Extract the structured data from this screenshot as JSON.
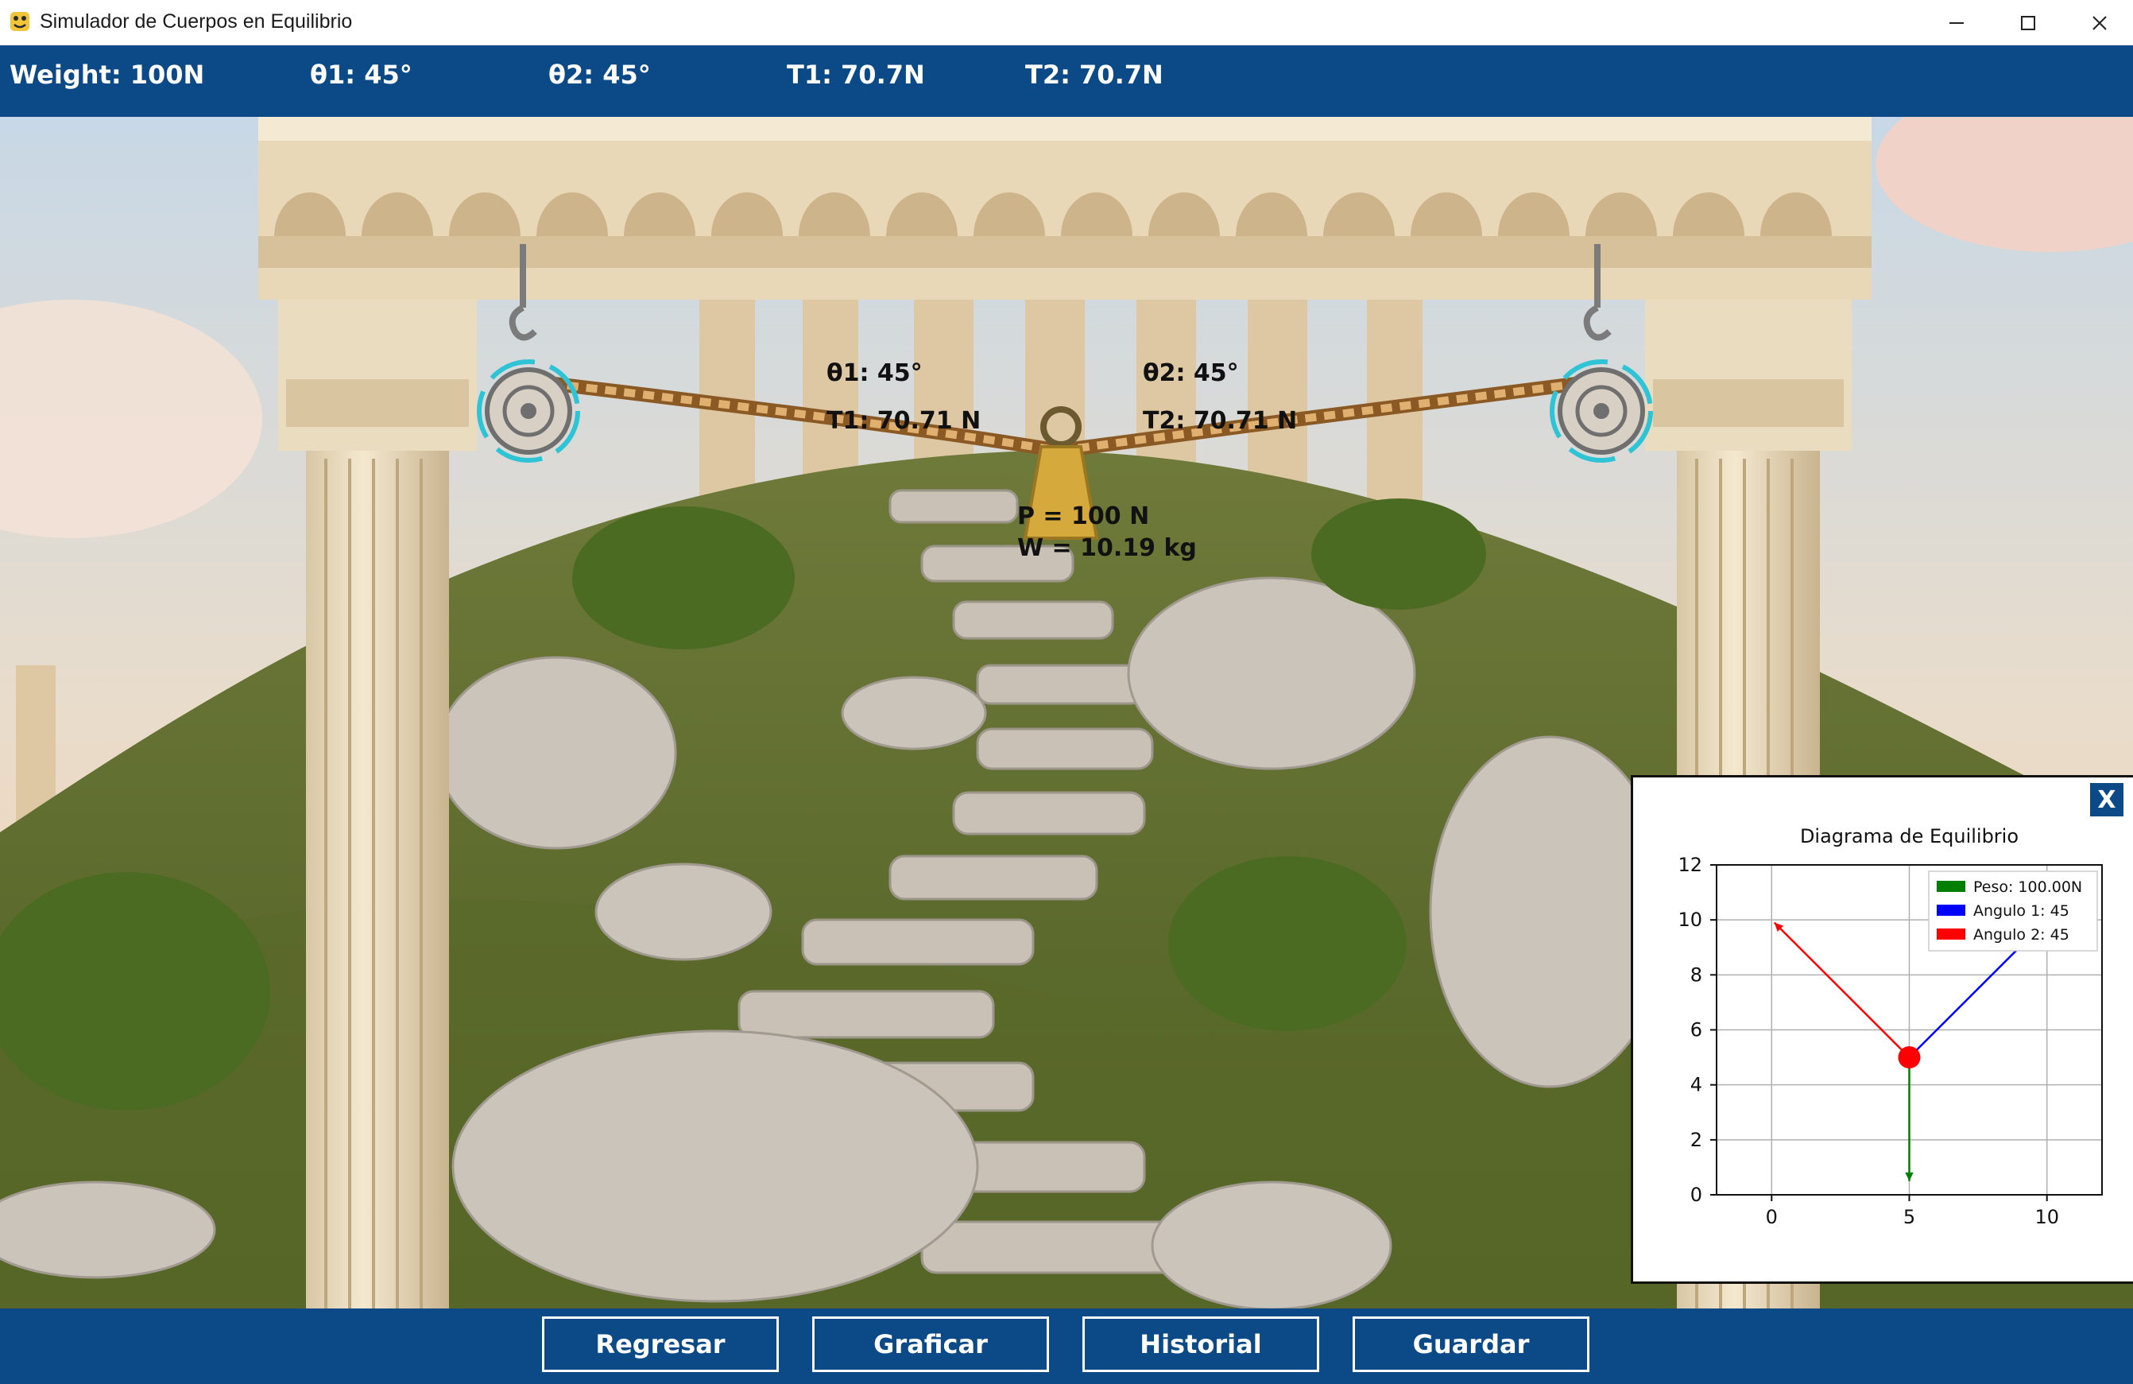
{
  "window": {
    "title": "Simulador de Cuerpos en Equilibrio"
  },
  "status": {
    "weight": "Weight: 100N",
    "theta1": "θ1: 45°",
    "theta2": "θ2: 45°",
    "t1": "T1: 70.7N",
    "t2": "T2: 70.7N"
  },
  "scene": {
    "left_angle": "θ1: 45°",
    "left_tension": "T1: 70.71 N",
    "right_angle": "θ2: 45°",
    "right_tension": "T2: 70.71 N",
    "weight_p": "P = 100 N",
    "weight_w": "W = 10.19 kg"
  },
  "buttons": {
    "back": "Regresar",
    "plot": "Graficar",
    "history": "Historial",
    "save": "Guardar"
  },
  "panel": {
    "close_label": "X"
  },
  "chart_data": {
    "type": "line",
    "title": "Diagrama de Equilibrio",
    "xlabel": "",
    "ylabel": "",
    "xlim": [
      -2,
      12
    ],
    "ylim": [
      0,
      12
    ],
    "xticks": [
      0,
      5,
      10
    ],
    "yticks": [
      0,
      2,
      4,
      6,
      8,
      10,
      12
    ],
    "grid": true,
    "legend_placement": "top-right",
    "origin": [
      5,
      5
    ],
    "series": [
      {
        "name": "Peso: 100.00N",
        "color": "#008000",
        "points": [
          [
            5,
            5
          ],
          [
            5,
            0.5
          ]
        ]
      },
      {
        "name": "Angulo 1: 45",
        "color": "#0000ff",
        "points": [
          [
            5,
            5
          ],
          [
            9.9,
            9.9
          ]
        ]
      },
      {
        "name": "Angulo 2: 45",
        "color": "#ff0000",
        "points": [
          [
            5,
            5
          ],
          [
            0.1,
            9.9
          ]
        ]
      }
    ]
  }
}
